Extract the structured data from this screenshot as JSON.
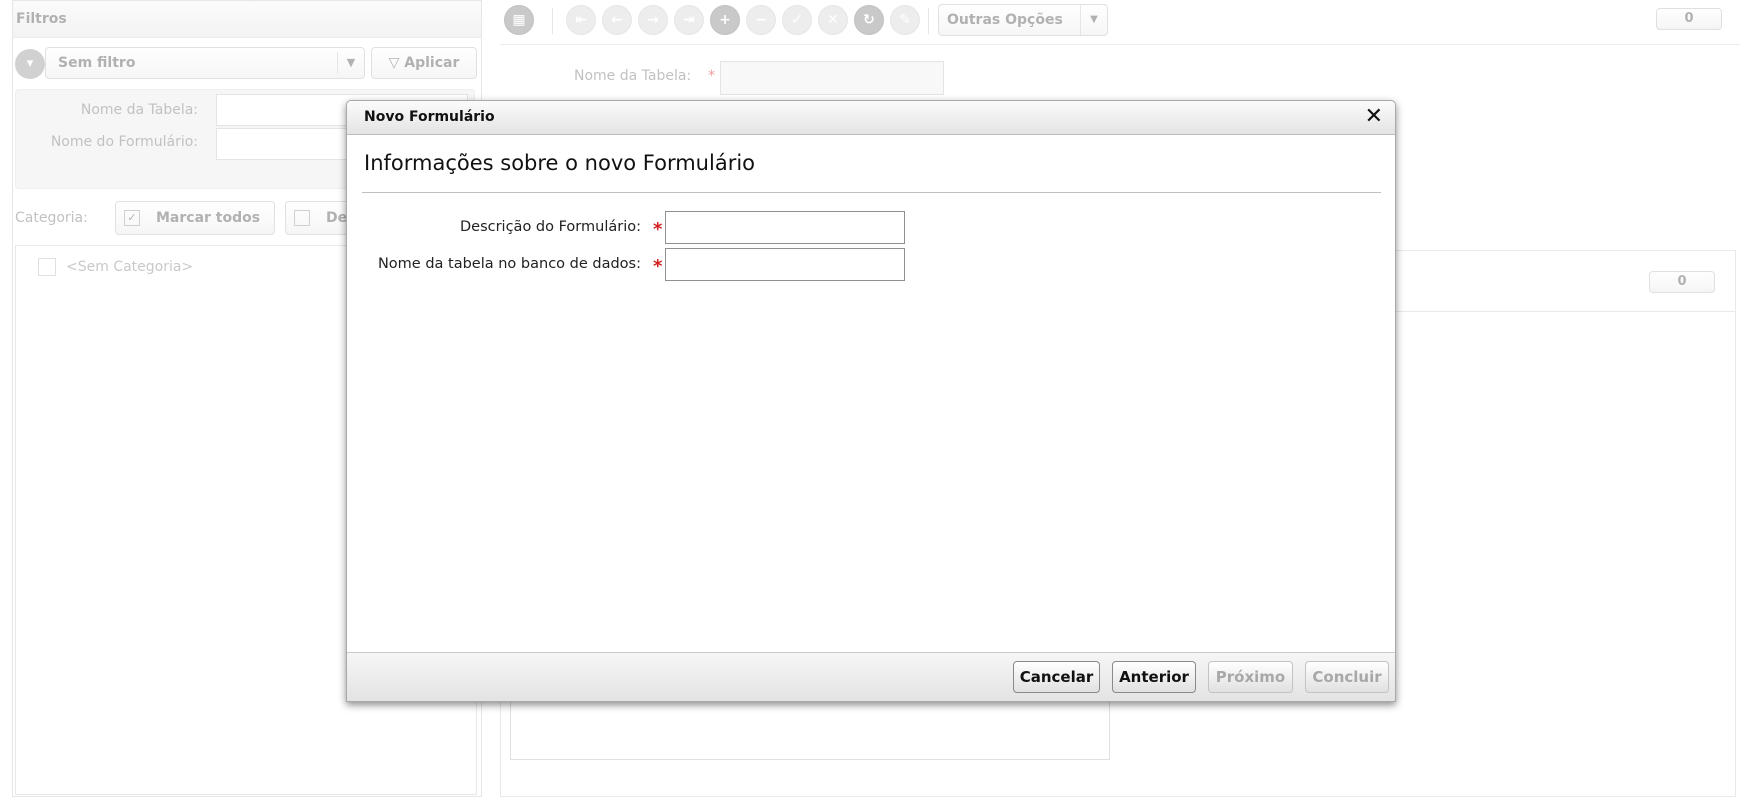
{
  "background": {
    "filters": {
      "title": "Filtros",
      "filter_select": "Sem filtro",
      "apply_label": "Aplicar",
      "table_name_label": "Nome da Tabela:",
      "form_name_label": "Nome do Formulário:",
      "category_label": "Categoria:",
      "select_all_label": "Marcar todos",
      "deselect_all_label": "De",
      "category_items": [
        "<Sem Categoria>"
      ]
    },
    "toolbar": {
      "other_options_label": "Outras Opções",
      "counter_top": "0",
      "counter_list": "0"
    },
    "detail": {
      "table_name_label": "Nome da Tabela:"
    }
  },
  "dialog": {
    "title": "Novo Formulário",
    "heading": "Informações sobre o novo Formulário",
    "fields": [
      {
        "label": "Descrição do Formulário:",
        "value": "",
        "required": true
      },
      {
        "label": "Nome da tabela no banco de dados:",
        "value": "",
        "required": true
      }
    ],
    "required_mark": "*",
    "buttons": {
      "cancel": "Cancelar",
      "previous": "Anterior",
      "next": "Próximo",
      "finish": "Concluir"
    }
  },
  "icons": {
    "close": "close-icon",
    "grid": "grid-icon",
    "filter": "filter-icon",
    "add": "plus-icon"
  }
}
